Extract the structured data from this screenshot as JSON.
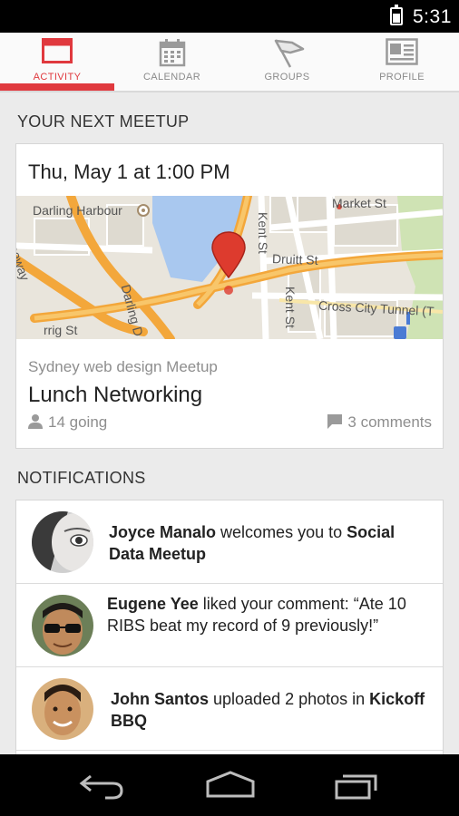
{
  "status_bar": {
    "time": "5:31"
  },
  "tabs": [
    {
      "label": "ACTIVITY",
      "active": true,
      "icon": "activity-icon"
    },
    {
      "label": "CALENDAR",
      "active": false,
      "icon": "calendar-icon"
    },
    {
      "label": "GROUPS",
      "active": false,
      "icon": "groups-flag-icon"
    },
    {
      "label": "PROFILE",
      "active": false,
      "icon": "profile-card-icon"
    }
  ],
  "next_meetup": {
    "section_title": "YOUR NEXT MEETUP",
    "date_time": "Thu, May 1 at 1:00 PM",
    "map": {
      "labels": {
        "darling_harbour": "Darling Harbour",
        "market_st": "Market St",
        "druitt_st": "Druitt St",
        "kent_st_top": "Kent St",
        "kent_st_bottom": "Kent St",
        "darling_dr": "Darling D",
        "cross_city_tunnel": "Cross City Tunnel (T",
        "freeway": "eeway",
        "pyrmont": "rrig St"
      }
    },
    "group_name": "Sydney web design Meetup",
    "event_title": "Lunch Networking",
    "going": "14 going",
    "comments": "3 comments"
  },
  "notifications": {
    "section_title": "NOTIFICATIONS",
    "items": [
      {
        "name": "Joyce Manalo",
        "action": " welcomes you to ",
        "target": "Social Data Meetup",
        "target2": ""
      },
      {
        "name": "Eugene Yee",
        "action": " liked your comment: “Ate 10 RIBS beat my record of 9 previously!”",
        "target": "",
        "target2": ""
      },
      {
        "name": "John Santos",
        "action": " uploaded 2 photos in ",
        "target": "Kickoff BBQ",
        "target2": ""
      }
    ]
  },
  "colors": {
    "accent": "#e0393e",
    "background": "#ebebeb"
  }
}
